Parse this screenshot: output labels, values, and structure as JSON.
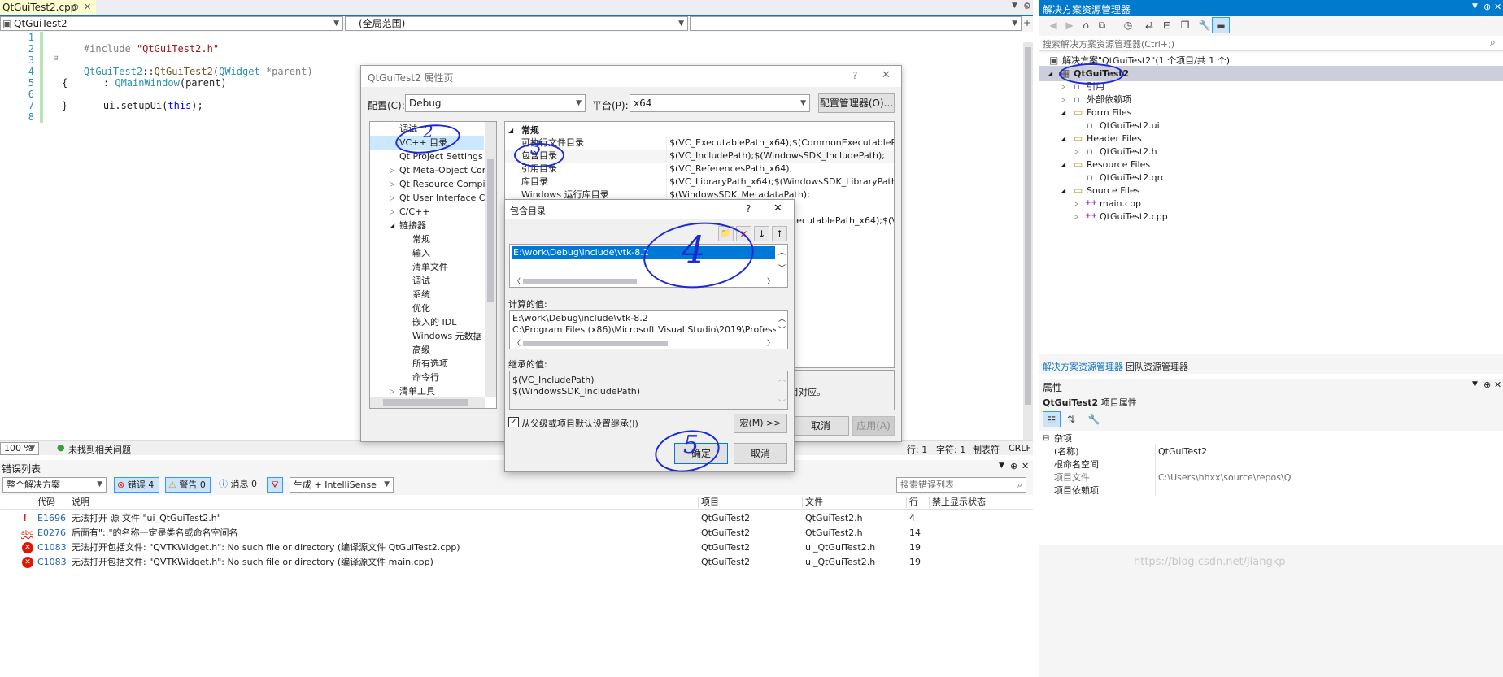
{
  "editor": {
    "tab_name": "QtGuiTest2.cpp",
    "tab_pin": "⊕",
    "tab_close": "✕",
    "class_combo": "QtGuiTest2",
    "scope_combo": "(全局范围)",
    "line_numbers": [
      "1",
      "2",
      "3",
      "4",
      "5",
      "6",
      "7",
      "8"
    ],
    "code": {
      "l1_kw": "#include ",
      "l1_str": "\"QtGuiTest2.h\"",
      "l3_a": "QtGuiTest2",
      "l3_b": "::",
      "l3_c": "QtGuiTest2",
      "l3_d": "(",
      "l3_e": "QWidget",
      "l3_f": " *parent)",
      "l4_a": ": ",
      "l4_b": "QMainWindow",
      "l4_c": "(parent)",
      "l5": "{",
      "l6_a": "ui.setupUi(",
      "l6_b": "this",
      "l6_c": ");",
      "l7": "}"
    },
    "zoom": "100 %",
    "status_ok": "未找到相关问题",
    "status_line": "行: 1",
    "status_col": "字符: 1",
    "status_tab": "制表符",
    "status_eol": "CRLF"
  },
  "prop_dialog": {
    "title": "QtGuiTest2 属性页",
    "help": "?",
    "close": "✕",
    "config_label": "配置(C):",
    "config_value": "Debug",
    "platform_label": "平台(P):",
    "platform_value": "x64",
    "config_manager": "配置管理器(O)...",
    "tree": [
      {
        "label": "调试",
        "indent": 0,
        "arrow": ""
      },
      {
        "label": "VC++ 目录",
        "indent": 0,
        "arrow": ""
      },
      {
        "label": "Qt Project Settings",
        "indent": 0,
        "arrow": ""
      },
      {
        "label": "Qt Meta-Object Com",
        "indent": 0,
        "arrow": "▷"
      },
      {
        "label": "Qt Resource Compile",
        "indent": 0,
        "arrow": "▷"
      },
      {
        "label": "Qt User Interface Co",
        "indent": 0,
        "arrow": "▷"
      },
      {
        "label": "C/C++",
        "indent": 0,
        "arrow": "▷"
      },
      {
        "label": "链接器",
        "indent": 0,
        "arrow": "◢"
      },
      {
        "label": "常规",
        "indent": 1,
        "arrow": ""
      },
      {
        "label": "输入",
        "indent": 1,
        "arrow": ""
      },
      {
        "label": "清单文件",
        "indent": 1,
        "arrow": ""
      },
      {
        "label": "调试",
        "indent": 1,
        "arrow": ""
      },
      {
        "label": "系统",
        "indent": 1,
        "arrow": ""
      },
      {
        "label": "优化",
        "indent": 1,
        "arrow": ""
      },
      {
        "label": "嵌入的 IDL",
        "indent": 1,
        "arrow": ""
      },
      {
        "label": "Windows 元数据",
        "indent": 1,
        "arrow": ""
      },
      {
        "label": "高级",
        "indent": 1,
        "arrow": ""
      },
      {
        "label": "所有选项",
        "indent": 1,
        "arrow": ""
      },
      {
        "label": "命令行",
        "indent": 1,
        "arrow": ""
      },
      {
        "label": "清单工具",
        "indent": 0,
        "arrow": "▷"
      }
    ],
    "section": "常规",
    "props": [
      {
        "name": "可执行文件目录",
        "value": "$(VC_ExecutablePath_x64);$(CommonExecutablePath)"
      },
      {
        "name": "包含目录",
        "value": "$(VC_IncludePath);$(WindowsSDK_IncludePath);"
      },
      {
        "name": "引用目录",
        "value": "$(VC_ReferencesPath_x64);"
      },
      {
        "name": "库目录",
        "value": "$(VC_LibraryPath_x64);$(WindowsSDK_LibraryPath_x64)"
      },
      {
        "name": "Windows 运行库目录",
        "value": "$(WindowsSDK_MetadataPath);"
      }
    ],
    "partial_value": "xecutablePath_x64);$(VC_I",
    "desc_tail": "目对应。",
    "cancel": "取消",
    "apply": "应用(A)"
  },
  "include_dialog": {
    "title": "包含目录",
    "help": "?",
    "close": "✕",
    "tools": [
      "📁",
      "✕",
      "↓",
      "↑"
    ],
    "entry": "E:\\work\\Debug\\include\\vtk-8.2",
    "computed_label": "计算的值:",
    "computed": [
      "E:\\work\\Debug\\include\\vtk-8.2",
      "C:\\Program Files (x86)\\Microsoft Visual Studio\\2019\\Professional\\"
    ],
    "inherited_label": "继承的值:",
    "inherited": [
      "$(VC_IncludePath)",
      "$(WindowsSDK_IncludePath)"
    ],
    "inherit_check": "从父级或项目默认设置继承(I)",
    "macro": "宏(M) >>",
    "ok": "确定",
    "cancel": "取消"
  },
  "annotations": [
    "2",
    "3",
    "4",
    "5"
  ],
  "solution_explorer": {
    "title": "解决方案资源管理器",
    "search": "搜索解决方案资源管理器(Ctrl+;)",
    "items": [
      {
        "label": "解决方案\"QtGuiTest2\"(1 个项目/共 1 个)",
        "level": 0,
        "arrow": "",
        "icon": "▣"
      },
      {
        "label": "QtGuiTest2",
        "level": 0,
        "arrow": "◢",
        "icon": "▦",
        "bold": true
      },
      {
        "label": "引用",
        "level": 1,
        "arrow": "▷",
        "icon": "▫"
      },
      {
        "label": "外部依赖项",
        "level": 1,
        "arrow": "▷",
        "icon": "▫"
      },
      {
        "label": "Form Files",
        "level": 1,
        "arrow": "◢",
        "icon": "▭"
      },
      {
        "label": "QtGuiTest2.ui",
        "level": 2,
        "arrow": "",
        "icon": "▫"
      },
      {
        "label": "Header Files",
        "level": 1,
        "arrow": "◢",
        "icon": "▭"
      },
      {
        "label": "QtGuiTest2.h",
        "level": 2,
        "arrow": "▷",
        "icon": "▫"
      },
      {
        "label": "Resource Files",
        "level": 1,
        "arrow": "◢",
        "icon": "▭"
      },
      {
        "label": "QtGuiTest2.qrc",
        "level": 2,
        "arrow": "",
        "icon": "▫"
      },
      {
        "label": "Source Files",
        "level": 1,
        "arrow": "◢",
        "icon": "▭"
      },
      {
        "label": "main.cpp",
        "level": 2,
        "arrow": "▷",
        "icon": "++"
      },
      {
        "label": "QtGuiTest2.cpp",
        "level": 2,
        "arrow": "▷",
        "icon": "++"
      }
    ],
    "tab1": "解决方案资源管理器",
    "tab2": "团队资源管理器"
  },
  "properties": {
    "title": "属性",
    "subject": "QtGuiTest2",
    "subject_suffix": " 项目属性",
    "category": "杂项",
    "rows": [
      {
        "name": "(名称)",
        "value": "QtGuiTest2"
      },
      {
        "name": "根命名空间",
        "value": ""
      },
      {
        "name": "项目文件",
        "value": "C:\\Users\\hhxx\\source\\repos\\Q"
      },
      {
        "name": "项目依赖项",
        "value": ""
      }
    ]
  },
  "error_list": {
    "title": "错误列表",
    "scope": "整个解决方案",
    "errors_btn": "错误 4",
    "warnings_btn": "警告 0",
    "messages_btn": "消息 0",
    "build_combo": "生成 + IntelliSense",
    "search": "搜索错误列表",
    "headers": [
      "代码",
      "说明",
      "项目",
      "文件",
      "行",
      "禁止显示状态"
    ],
    "rows": [
      {
        "icon": "!",
        "code": "E1696",
        "desc": "无法打开 源 文件 \"ui_QtGuiTest2.h\"",
        "project": "QtGuiTest2",
        "file": "QtGuiTest2.h",
        "line": "4"
      },
      {
        "icon": "abc",
        "code": "E0276",
        "desc": "后面有\"::\"的名称一定是类名或命名空间名",
        "project": "QtGuiTest2",
        "file": "QtGuiTest2.h",
        "line": "14"
      },
      {
        "icon": "✕",
        "code": "C1083",
        "desc": "无法打开包括文件: \"QVTKWidget.h\": No such file or directory (编译源文件 QtGuiTest2.cpp)",
        "project": "QtGuiTest2",
        "file": "ui_QtGuiTest2.h",
        "line": "19"
      },
      {
        "icon": "✕",
        "code": "C1083",
        "desc": "无法打开包括文件: \"QVTKWidget.h\": No such file or directory (编译源文件 main.cpp)",
        "project": "QtGuiTest2",
        "file": "ui_QtGuiTest2.h",
        "line": "19"
      }
    ]
  },
  "watermark": "https://blog.csdn.net/jiangkp"
}
